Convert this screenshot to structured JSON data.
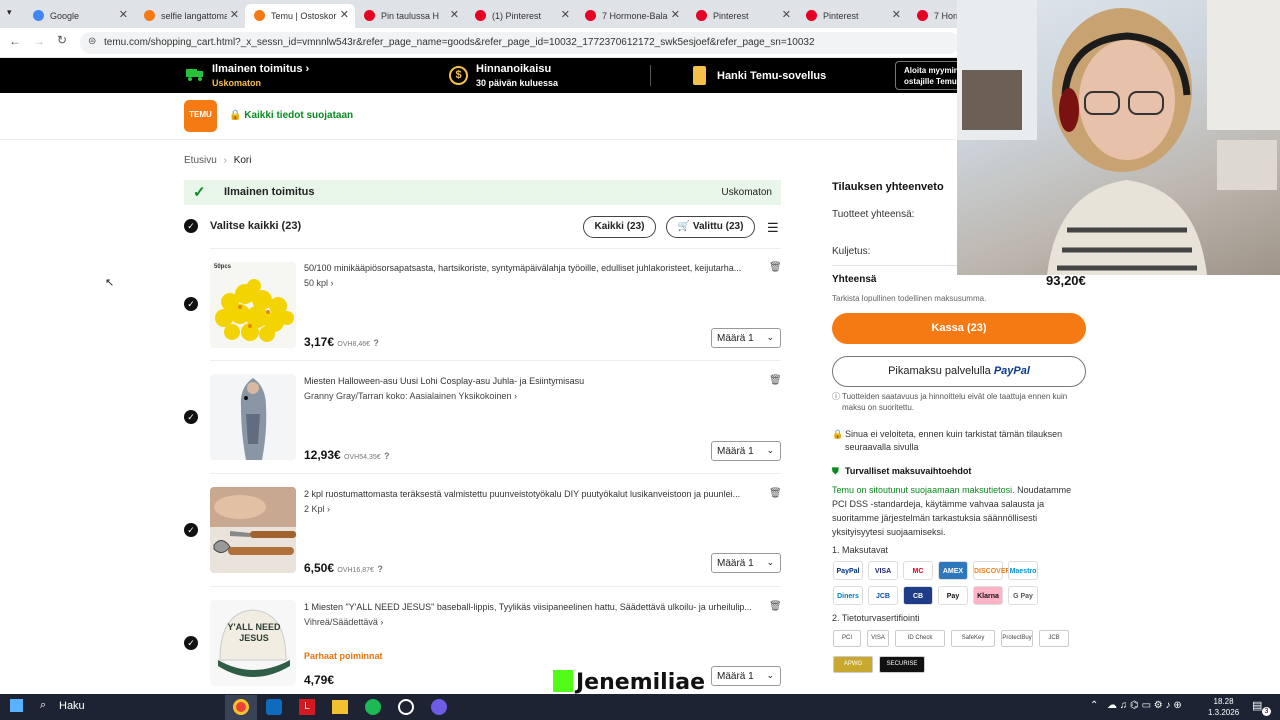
{
  "tabs": [
    {
      "title": "Google",
      "color": "#4285f4"
    },
    {
      "title": "selfie langattomat",
      "color": "#f57a14"
    },
    {
      "title": "Temu | Ostoskori",
      "color": "#f57a14"
    },
    {
      "title": "Pin taulussa H",
      "color": "#e60023"
    },
    {
      "title": "(1) Pinterest",
      "color": "#e60023"
    },
    {
      "title": "7 Hormone-Balan",
      "color": "#e60023"
    },
    {
      "title": "Pinterest",
      "color": "#e60023"
    },
    {
      "title": "Pinterest",
      "color": "#e60023"
    },
    {
      "title": "7 Horm",
      "color": "#e60023"
    }
  ],
  "address": {
    "url": "temu.com/shopping_cart.html?_x_sessn_id=vmnnlw543r&refer_page_name=goods&refer_page_id=10032_1772370612172_swk5esjoef&refer_page_sn=10032"
  },
  "promo": {
    "free_shipping": "Ilmainen toimitus",
    "free_shipping_sub": "Uskomaton",
    "price_adjust": "Hinnanoikaisu",
    "price_adjust_sub": "30 päivän kuluessa",
    "app": "Hanki Temu-sovellus",
    "new_users_1": "Aloita myymin",
    "new_users_2": "ostajille Temu"
  },
  "header": {
    "logo": "TEMU",
    "secure": "Kaikki tiedot suojataan"
  },
  "breadcrumb": {
    "home": "Etusivu",
    "current": "Kori"
  },
  "cart": {
    "free_shipping": "Ilmainen toimitus",
    "free_shipping_status": "Uskomaton",
    "select_all": "Valitse kaikki (23)",
    "all_button": "Kaikki (23)",
    "selected_button": "Valittu (23)",
    "qty_label": "Määrä 1",
    "best_pick": "Parhaat poiminnat",
    "items": [
      {
        "title": "50/100 minikääpiösorsapatsasta, hartsikoriste, syntymäpäivälahja työoille, edulliset juhlakoristeet, keijutarha...",
        "variant": "50 kpl",
        "price": "3,17€",
        "orig": "OVH8,46€",
        "image_label": "50pcs"
      },
      {
        "title": "Miesten Halloween-asu Uusi Lohi Cosplay-asu Juhla- ja Esiintymisasu",
        "variant": "Granny Gray/Tarran koko: Aasialainen Yksikokoinen",
        "price": "12,93€",
        "orig": "OVH54,35€"
      },
      {
        "title": "2 kpl ruostumattomasta teräksestä valmistettu puunveistotyökalu DIY puutyökalut lusikanveistoon ja puunlei...",
        "variant": "2 Kpl",
        "price": "6,50€",
        "orig": "OVH16,87€"
      },
      {
        "title": "1 Miesten \"Y'ALL NEED JESUS\" baseball-lippis, Tyylikäs viisipaneelinen hattu, Säädettävä ulkoilu- ja urheilulip...",
        "variant": "Vihreä/Säädettävä",
        "price": "4,79€",
        "orig": "",
        "image_label": "Y'ALL NEED JESUS"
      }
    ]
  },
  "summary": {
    "title": "Tilauksen yhteenveto",
    "items_total": "Tuotteet yhteensä:",
    "shipping": "Kuljetus:",
    "total_label": "Yhteensä",
    "total": "93,20€",
    "check_note": "Tarkista lopullinen todellinen maksusumma.",
    "checkout": "Kassa (23)",
    "paypal_prefix": "Pikamaksu palvelulla",
    "paypal": "PayPal",
    "availability": "Tuotteiden saatavuus ja hinnoittelu eivät ole taattuja ennen kuin maksu on suoritettu.",
    "not_charged": "Sinua ei veloiteta, ennen kuin tarkistat tämän tilauksen seuraavalla sivulla",
    "secure_title": "Turvalliset maksuvaihtoehdot",
    "secure_link": "Temu on sitoutunut suojaamaan maksutietosi.",
    "secure_body": "Noudatamme PCI DSS -standardeja, käytämme vahvaa salausta ja suoritamme järjestelmän tarkastuksia säännöllisesti yksityisyytesi suojaamiseksi.",
    "methods_title": "1. Maksutavat",
    "cards": [
      "PayPal",
      "VISA",
      "MC",
      "AMEX",
      "DISCOVER",
      "Maestro",
      "Diners",
      "JCB",
      "CB",
      "Pay",
      "Klarna",
      "G Pay"
    ],
    "certs_title": "2. Tietoturvasertifiointi",
    "certs": [
      "PCI",
      "VISA",
      "ID Check",
      "SafeKey",
      "ProtectBuy",
      "JCB",
      "APWG",
      "SECURISE"
    ]
  },
  "overlay": {
    "watermark": "Jenemiliae"
  },
  "taskbar": {
    "search": "Haku",
    "time": "18.28",
    "date": "1.3.2026",
    "notif": "3"
  }
}
